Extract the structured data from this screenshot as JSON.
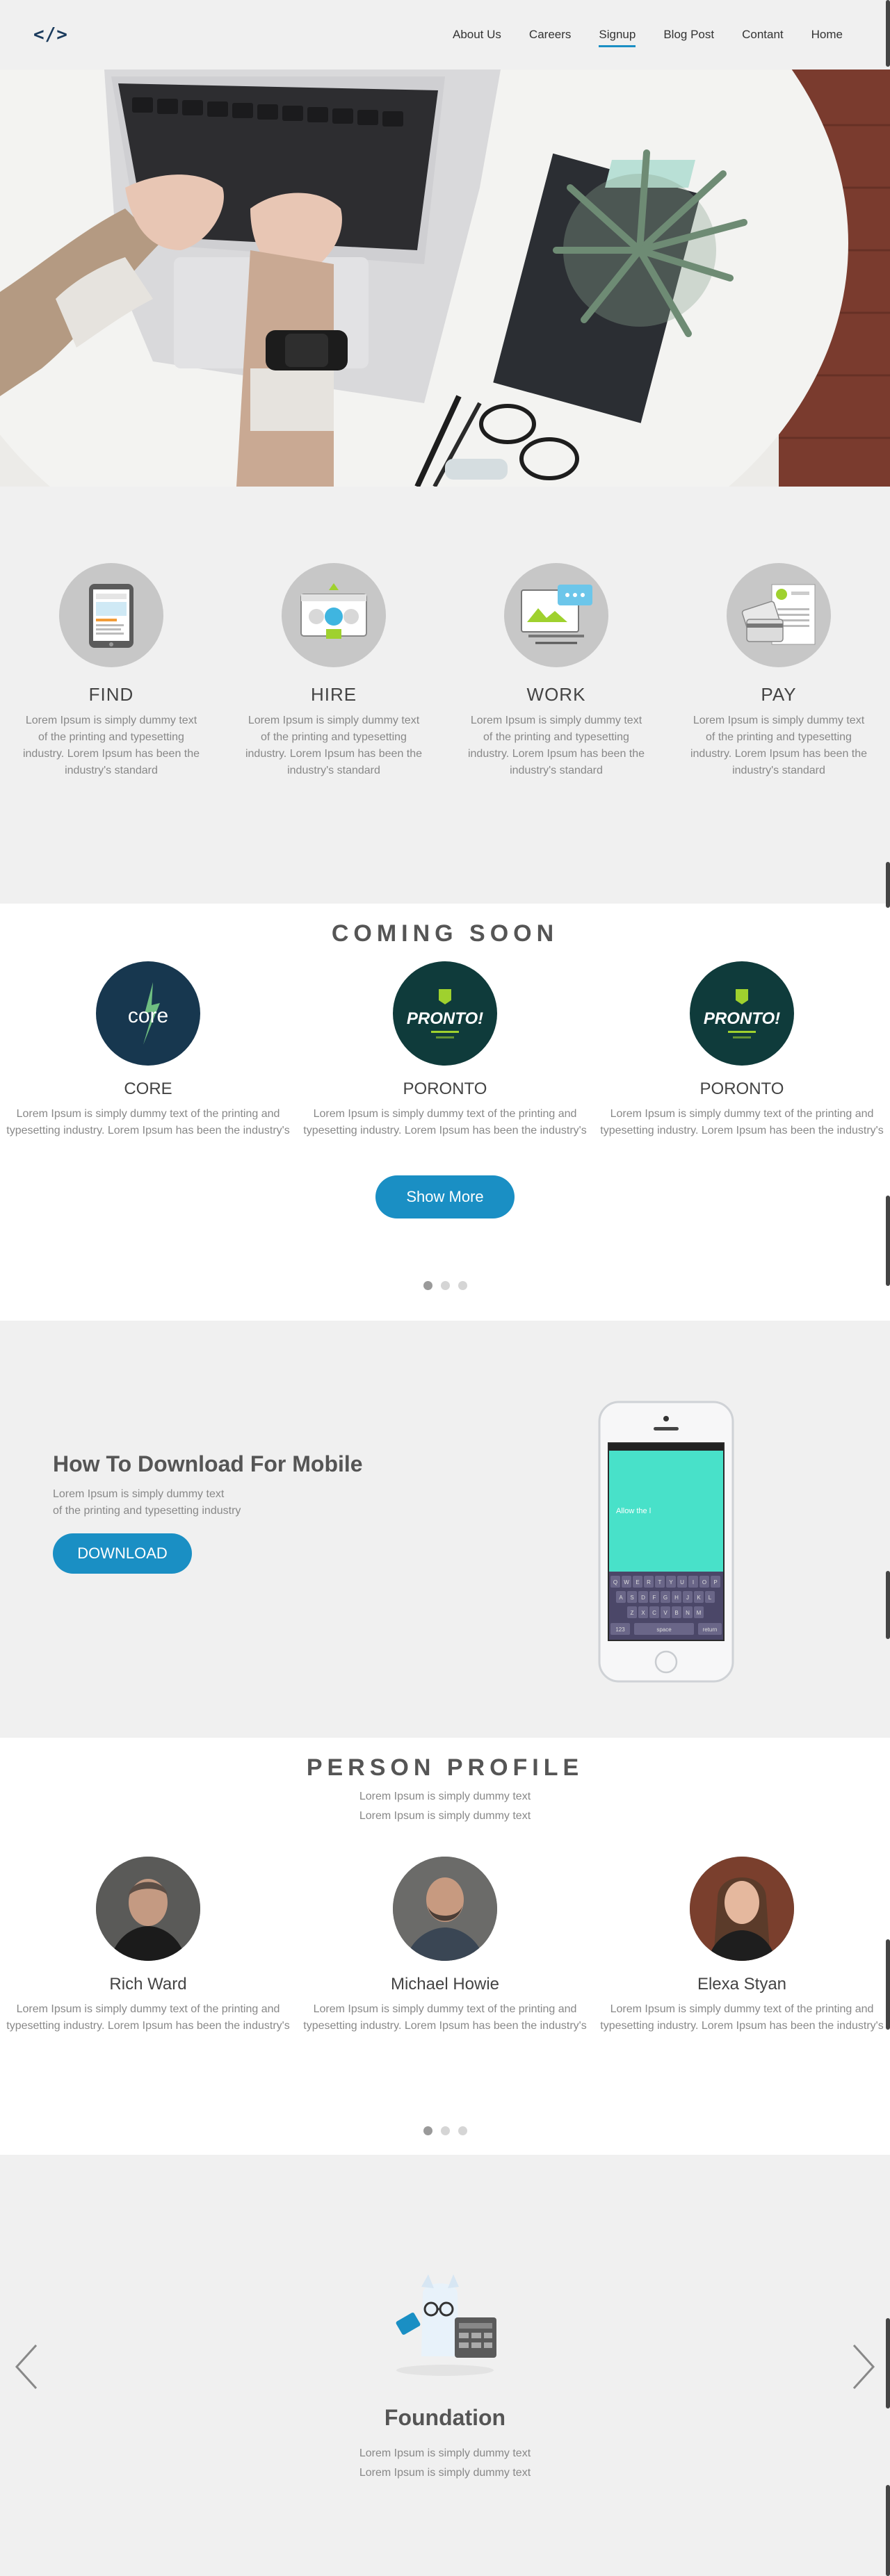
{
  "header": {
    "logo": "</>",
    "nav": [
      {
        "label": "About Us",
        "active": false
      },
      {
        "label": "Careers",
        "active": false
      },
      {
        "label": "Signup",
        "active": true
      },
      {
        "label": "Blog Post",
        "active": false
      },
      {
        "label": "Contant",
        "active": false
      },
      {
        "label": "Home",
        "active": false
      }
    ]
  },
  "features": [
    {
      "title": "FIND",
      "text": "Lorem Ipsum is simply dummy text of the printing and typesetting industry. Lorem Ipsum has been the industry's standard",
      "icon": "job-post-tablet-icon"
    },
    {
      "title": "HIRE",
      "text": "Lorem Ipsum is simply dummy text of the printing and typesetting industry. Lorem Ipsum has been the industry's standard",
      "icon": "hire-candidates-icon"
    },
    {
      "title": "WORK",
      "text": "Lorem Ipsum is simply dummy text of the printing and typesetting industry. Lorem Ipsum has been the industry's standard",
      "icon": "work-monitor-icon"
    },
    {
      "title": "PAY",
      "text": "Lorem Ipsum is simply dummy text of the printing and typesetting industry. Lorem Ipsum has been the industry's standard",
      "icon": "invoice-pay-icon"
    }
  ],
  "coming_soon": {
    "title": "COMING SOON",
    "items": [
      {
        "name": "CORE",
        "text": "Lorem Ipsum is simply dummy text of the printing and typesetting industry. Lorem Ipsum has been the industry's",
        "logo": "core"
      },
      {
        "name": "PORONTO",
        "text": "Lorem Ipsum is simply dummy text of the printing and typesetting industry. Lorem Ipsum has been the industry's",
        "logo": "PRONTO!"
      },
      {
        "name": "PORONTO",
        "text": "Lorem Ipsum is simply dummy text of the printing and typesetting industry. Lorem Ipsum has been the industry's",
        "logo": "PRONTO!"
      }
    ],
    "button": "Show More"
  },
  "download": {
    "title": "How To Download For Mobile",
    "line1": "Lorem Ipsum is simply dummy text",
    "line2": "of the printing and typesetting industry",
    "button": "DOWNLOAD",
    "phone_text": "Allow the l",
    "keys_row1": [
      "Q",
      "W",
      "E",
      "R",
      "T",
      "Y",
      "U",
      "I",
      "O",
      "P"
    ],
    "keys_row2": [
      "A",
      "S",
      "D",
      "F",
      "G",
      "H",
      "J",
      "K",
      "L"
    ],
    "keys_row3": [
      "Z",
      "X",
      "C",
      "V",
      "B",
      "N",
      "M"
    ],
    "key_space": "space",
    "key_return": "return",
    "key_num": "123"
  },
  "profiles": {
    "title": "PERSON PROFILE",
    "sub1": "Lorem Ipsum is simply dummy text",
    "sub2": "Lorem Ipsum is simply dummy text",
    "people": [
      {
        "name": "Rich Ward",
        "text": "Lorem Ipsum is simply dummy text of the printing and typesetting industry. Lorem Ipsum has been the industry's"
      },
      {
        "name": "Michael Howie",
        "text": "Lorem Ipsum is simply dummy text of the printing and typesetting industry. Lorem Ipsum has been the industry's"
      },
      {
        "name": "Elexa Styan",
        "text": "Lorem Ipsum is simply dummy text of the printing and typesetting industry. Lorem Ipsum has been the industry's"
      }
    ]
  },
  "foundation": {
    "title": "Foundation",
    "sub1": "Lorem Ipsum is simply dummy text",
    "sub2": "Lorem Ipsum is simply dummy text"
  },
  "colors": {
    "accent": "#1a8fc4",
    "background": "#f0f0f0",
    "text": "#555555",
    "muted": "#888888"
  }
}
